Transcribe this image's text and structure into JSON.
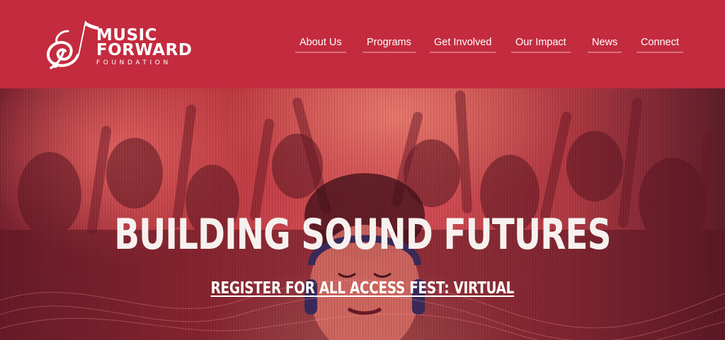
{
  "header": {
    "logo": {
      "line1": "MUSIC",
      "line2": "FORWARD",
      "line3": "FOUNDATION",
      "mark_icon": "treble-clef-note-icon"
    },
    "nav": [
      {
        "label": "About Us"
      },
      {
        "label": "Programs"
      },
      {
        "label": "Get Involved"
      },
      {
        "label": "Our Impact"
      },
      {
        "label": "News"
      },
      {
        "label": "Connect"
      }
    ]
  },
  "hero": {
    "headline": "BUILDING SOUND FUTURES",
    "cta_label": "REGISTER FOR ALL ACCESS FEST: VIRTUAL",
    "image_subject": "concert crowd with raised hands and woman wearing headphones"
  },
  "colors": {
    "header_bg": "#c42b3f",
    "hero_tint": "#c9474a",
    "text": "#ffffff"
  }
}
